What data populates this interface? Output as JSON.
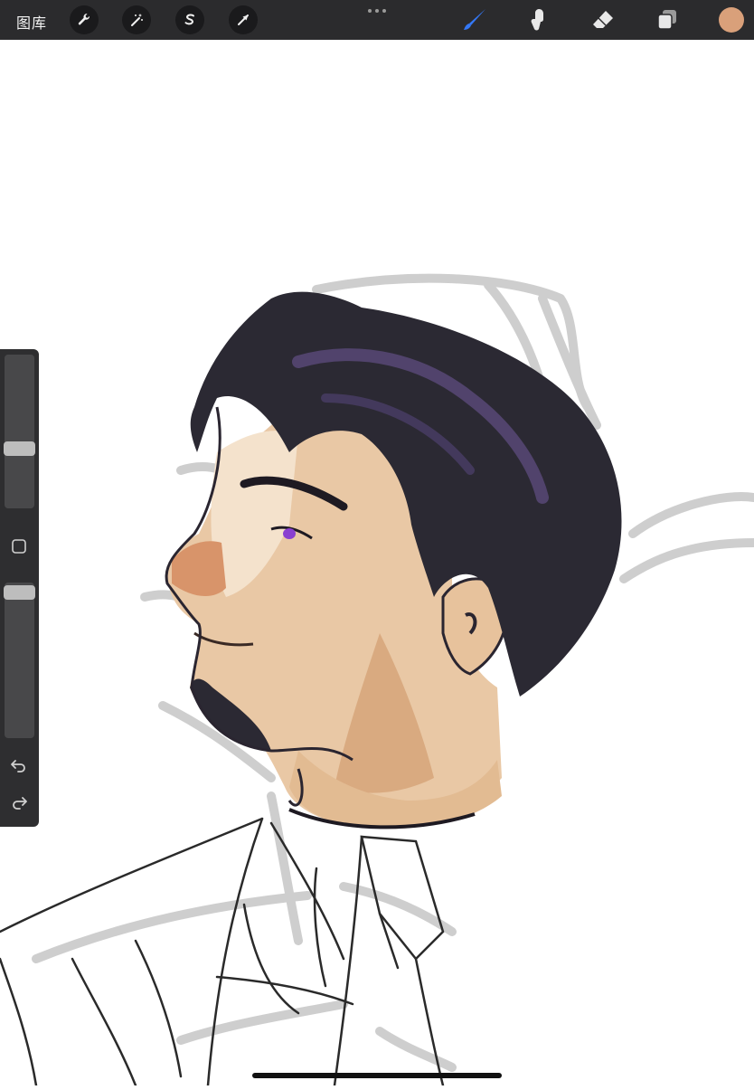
{
  "topbar": {
    "gallery_label": "图库",
    "left_tools": [
      {
        "icon": "wrench-icon",
        "name": "actions"
      },
      {
        "icon": "magic-wand-icon",
        "name": "adjustments"
      },
      {
        "icon": "selection-s-icon",
        "name": "selection"
      },
      {
        "icon": "arrow-cursor-icon",
        "name": "transform"
      }
    ],
    "right_tools": [
      {
        "icon": "brush-icon",
        "name": "brush",
        "active": true
      },
      {
        "icon": "smudge-icon",
        "name": "smudge"
      },
      {
        "icon": "eraser-icon",
        "name": "eraser"
      },
      {
        "icon": "layers-icon",
        "name": "layers"
      }
    ],
    "color_swatch": "#d9a07a",
    "accent_color": "#3478f6"
  },
  "sidebar": {
    "brush_size_level": 0.6,
    "opacity_level": 0.05,
    "modify_button_icon": "square-icon",
    "undo_icon": "undo-icon",
    "redo_icon": "redo-icon"
  },
  "canvas": {
    "artwork": "digital-portrait-sketch"
  }
}
